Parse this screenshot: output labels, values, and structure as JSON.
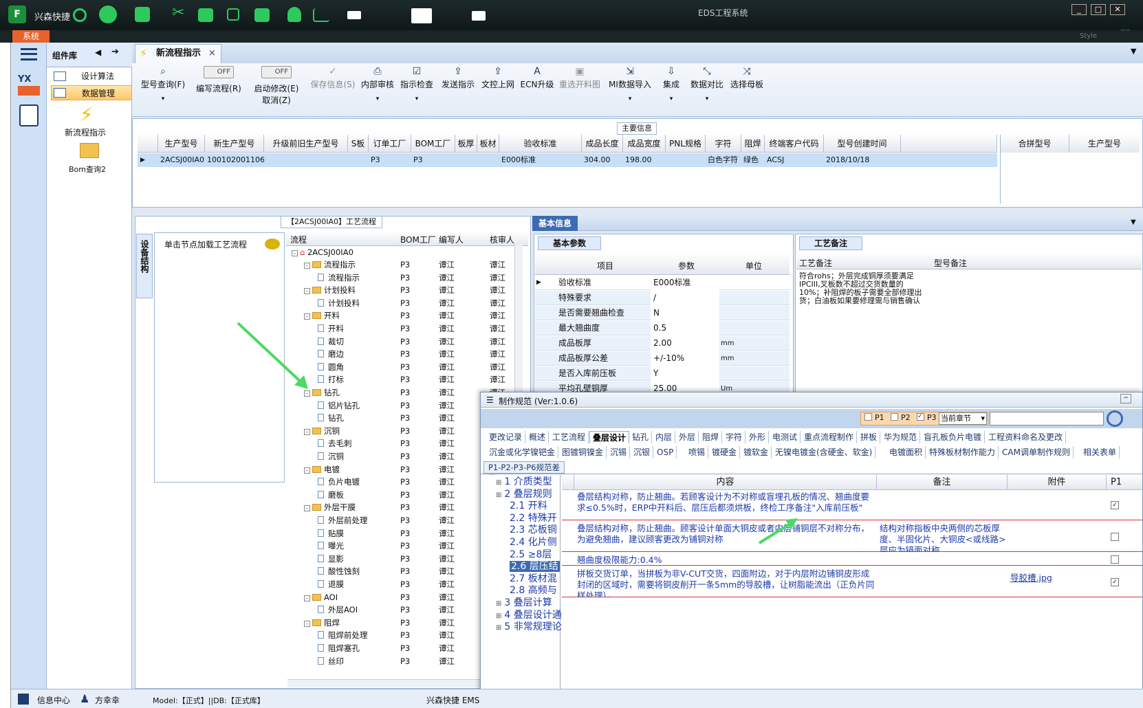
{
  "app": {
    "title": "兴森快捷",
    "window_title": "EDS工程系统",
    "system_menu": "系统",
    "style_label": "Style"
  },
  "nav": {
    "panel_title": "组件库",
    "items": [
      "设计算法",
      "数据管理"
    ],
    "big_items": [
      "新流程指示",
      "Bom查询2"
    ],
    "logo_text": "YX"
  },
  "tab": {
    "label": "新流程指示"
  },
  "toolbar": {
    "btn_query": "型号查询(F)",
    "toggle_off": "OFF",
    "btn_write": "编写流程(R)",
    "btn_start_line1": "启动修改(E)",
    "btn_start_line2": "取消(Z)",
    "btn_save": "保存信息(S)",
    "btn_review": "内部审核",
    "btn_check": "指示检查",
    "btn_send": "发送指示",
    "btn_upload": "文控上网",
    "btn_ecn": "ECN升级",
    "btn_redo": "重选开料图",
    "btn_mi": "MI数据导入",
    "btn_integrate": "集成",
    "btn_compare": "数据对比",
    "btn_mother": "选择母板"
  },
  "main_info": {
    "title": "主要信息",
    "headers": [
      "生产型号",
      "新生产型号",
      "升级前旧生产型号",
      "S板",
      "订单工厂",
      "BOM工厂",
      "板厚",
      "板材",
      "验收标准",
      "成品长度",
      "成品宽度",
      "PNL规格",
      "字符",
      "阻焊",
      "终端客户代码",
      "型号创建时间"
    ],
    "row": [
      "2ACSJ00IA0",
      "10010200110642",
      "",
      "",
      "P3",
      "P3",
      "",
      "",
      "E000标准",
      "304.00",
      "198.00",
      "",
      "白色字符",
      "绿色",
      "ACSJ",
      "2018/10/18"
    ],
    "side_headers": [
      "合拼型号",
      "生产型号"
    ]
  },
  "flow": {
    "title": "【2ACSJ00IA0】工艺流程",
    "vert_tab": "设备结构",
    "click_hint": "单击节点加载工艺流程",
    "headers": [
      "流程",
      "BOM工厂",
      "编写人",
      "核审人"
    ],
    "root": "2ACSJ00IA0",
    "rows": [
      {
        "label": "流程指示",
        "level": 1,
        "folder": true,
        "f": "P3",
        "w": "谭江",
        "r": "谭江"
      },
      {
        "label": "流程指示",
        "level": 2,
        "folder": false,
        "f": "P3",
        "w": "谭江",
        "r": "谭江"
      },
      {
        "label": "计划投料",
        "level": 1,
        "folder": true,
        "f": "P3",
        "w": "谭江",
        "r": "谭江"
      },
      {
        "label": "计划投料",
        "level": 2,
        "folder": false,
        "f": "P3",
        "w": "谭江",
        "r": "谭江"
      },
      {
        "label": "开料",
        "level": 1,
        "folder": true,
        "f": "P3",
        "w": "谭江",
        "r": "谭江"
      },
      {
        "label": "开料",
        "level": 2,
        "folder": false,
        "f": "P3",
        "w": "谭江",
        "r": "谭江"
      },
      {
        "label": "裁切",
        "level": 2,
        "folder": false,
        "f": "P3",
        "w": "谭江",
        "r": "谭江"
      },
      {
        "label": "磨边",
        "level": 2,
        "folder": false,
        "f": "P3",
        "w": "谭江",
        "r": "谭江"
      },
      {
        "label": "圆角",
        "level": 2,
        "folder": false,
        "f": "P3",
        "w": "谭江",
        "r": "谭江"
      },
      {
        "label": "打标",
        "level": 2,
        "folder": false,
        "f": "P3",
        "w": "谭江",
        "r": "谭江"
      },
      {
        "label": "钻孔",
        "level": 1,
        "folder": true,
        "f": "P3",
        "w": "谭江",
        "r": "谭江"
      },
      {
        "label": "铝片钻孔",
        "level": 2,
        "folder": false,
        "f": "P3",
        "w": "谭江",
        "r": "谭江"
      },
      {
        "label": "钻孔",
        "level": 2,
        "folder": false,
        "f": "P3",
        "w": "谭江",
        "r": "谭江"
      },
      {
        "label": "沉铜",
        "level": 1,
        "folder": true,
        "f": "P3",
        "w": "谭江",
        "r": "谭江"
      },
      {
        "label": "去毛刺",
        "level": 2,
        "folder": false,
        "f": "P3",
        "w": "谭江",
        "r": "谭江"
      },
      {
        "label": "沉铜",
        "level": 2,
        "folder": false,
        "f": "P3",
        "w": "谭江",
        "r": "谭江"
      },
      {
        "label": "电镀",
        "level": 1,
        "folder": true,
        "f": "P3",
        "w": "谭江",
        "r": "谭江"
      },
      {
        "label": "负片电镀",
        "level": 2,
        "folder": false,
        "f": "P3",
        "w": "谭江",
        "r": "谭江"
      },
      {
        "label": "磨板",
        "level": 2,
        "folder": false,
        "f": "P3",
        "w": "谭江",
        "r": "谭江"
      },
      {
        "label": "外层干膜",
        "level": 1,
        "folder": true,
        "f": "P3",
        "w": "谭江",
        "r": "谭江"
      },
      {
        "label": "外层前处理",
        "level": 2,
        "folder": false,
        "f": "P3",
        "w": "谭江",
        "r": "谭江"
      },
      {
        "label": "贴膜",
        "level": 2,
        "folder": false,
        "f": "P3",
        "w": "谭江",
        "r": "谭江"
      },
      {
        "label": "曝光",
        "level": 2,
        "folder": false,
        "f": "P3",
        "w": "谭江",
        "r": "谭江"
      },
      {
        "label": "显影",
        "level": 2,
        "folder": false,
        "f": "P3",
        "w": "谭江",
        "r": "谭江"
      },
      {
        "label": "酸性蚀刻",
        "level": 2,
        "folder": false,
        "f": "P3",
        "w": "谭江",
        "r": "谭江"
      },
      {
        "label": "退膜",
        "level": 2,
        "folder": false,
        "f": "P3",
        "w": "谭江",
        "r": "谭江"
      },
      {
        "label": "AOI",
        "level": 1,
        "folder": true,
        "f": "P3",
        "w": "谭江",
        "r": "谭江"
      },
      {
        "label": "外层AOI",
        "level": 2,
        "folder": false,
        "f": "P3",
        "w": "谭江",
        "r": "谭江"
      },
      {
        "label": "阻焊",
        "level": 1,
        "folder": true,
        "f": "P3",
        "w": "谭江",
        "r": "谭江"
      },
      {
        "label": "阻焊前处理",
        "level": 2,
        "folder": false,
        "f": "P3",
        "w": "谭江",
        "r": "谭江"
      },
      {
        "label": "阻焊塞孔",
        "level": 2,
        "folder": false,
        "f": "P3",
        "w": "谭江",
        "r": "谭江"
      },
      {
        "label": "丝印",
        "level": 2,
        "folder": false,
        "f": "P3",
        "w": "谭江",
        "r": "谭江"
      }
    ]
  },
  "basic": {
    "tab": "基本信息",
    "sub_tab": "基本参数",
    "headers": [
      "项目",
      "参数",
      "单位"
    ],
    "rows": [
      {
        "item": "验收标准",
        "val": "E000标准",
        "unit": ""
      },
      {
        "item": "特殊要求",
        "val": "/",
        "unit": ""
      },
      {
        "item": "是否需要翘曲检查",
        "val": "N",
        "unit": ""
      },
      {
        "item": "最大翘曲度",
        "val": "0.5",
        "unit": ""
      },
      {
        "item": "成品板厚",
        "val": "2.00",
        "unit": "mm"
      },
      {
        "item": "成品板厚公差",
        "val": "+/-10%",
        "unit": "mm"
      },
      {
        "item": "是否入库前压板",
        "val": "Y",
        "unit": ""
      },
      {
        "item": "平均孔壁铜厚",
        "val": "25.00",
        "unit": "Um"
      }
    ],
    "remark_tab": "工艺备注",
    "remark_headers": [
      "工艺备注",
      "型号备注"
    ],
    "remark_text": "符合rohs；外层完成铜厚须要满足IPCIII,叉板数不超过交货数量的10%；补阻焊的板子需要全部修理出货；白油板如果要修理需与销售确认"
  },
  "dialog": {
    "title": "制作规范 (Ver:1.0.6)",
    "checks": [
      "P1",
      "P2",
      "P3"
    ],
    "scope": "当前章节",
    "tabs_row1": [
      "更改记录",
      "概述",
      "工艺流程",
      "叠层设计",
      "钻孔",
      "内层",
      "外层",
      "阻焊",
      "字符",
      "外形",
      "电测试",
      "重点流程制作",
      "拼板",
      "华为规范",
      "盲孔板负片电镀",
      "工程资料命名及更改"
    ],
    "tabs_row2": [
      "沉金或化学镍钯金",
      "图镀铜镍金",
      "沉锡",
      "沉银",
      "OSP",
      "喷锡",
      "镀硬金",
      "镀软金",
      "无镍电镀金(含硬金、软金)",
      "电镀面积",
      "特殊板材制作能力",
      "CAM调单制作规则",
      "相关表单"
    ],
    "tabs_row3": [
      "P1-P2-P3-P6规范差异"
    ],
    "toc": [
      "1 介质类型",
      "2 叠层规则",
      "2.1 开料",
      "2.2 特殊开",
      "2.3 芯板铜",
      "2.4 化片侧",
      "2.5 ≥8层",
      "2.6 层压结",
      "2.7 板材混",
      "2.8 高频与",
      "3 叠层计算",
      "4 叠层设计通",
      "5 非常规理论"
    ],
    "grid_headers": [
      "内容",
      "备注",
      "附件",
      "P1"
    ],
    "grid_rows": [
      {
        "content": "叠层结构对称，防止翘曲。若顾客设计为不对称或盲埋孔板的情况、翘曲度要求≤0.5%时，ERP中开料后、层压后都须烘板，终检工序备注\"入库前压板\"",
        "note": "",
        "file": ""
      },
      {
        "content": "叠层结构对称，防止翘曲。顾客设计单面大铜皮或者内层铺铜层不对称分布，为避免翘曲，建议顾客更改为铺铜对称",
        "note": "结构对称指板中央两侧的芯板厚度、半固化片、大铜皮<或线路>层应为镜面对称",
        "file": ""
      },
      {
        "content": "翘曲度极限能力:0.4%",
        "note": "",
        "file": ""
      },
      {
        "content": "拼板交货订单，当拼板为非V-CUT交货，四面附边，对于内层附边铺铜皮形成封闭的区域时，需要将铜皮削开一条5mm的导胶槽，让树脂能流出（正负片同样处理）。",
        "note": "",
        "file": "导胶槽.jpg"
      }
    ]
  },
  "status": {
    "info_center": "信息中心",
    "user": "方幸幸",
    "model": "Model:【正式】||DB:【正式库】",
    "company": "兴森快捷 EMS"
  }
}
